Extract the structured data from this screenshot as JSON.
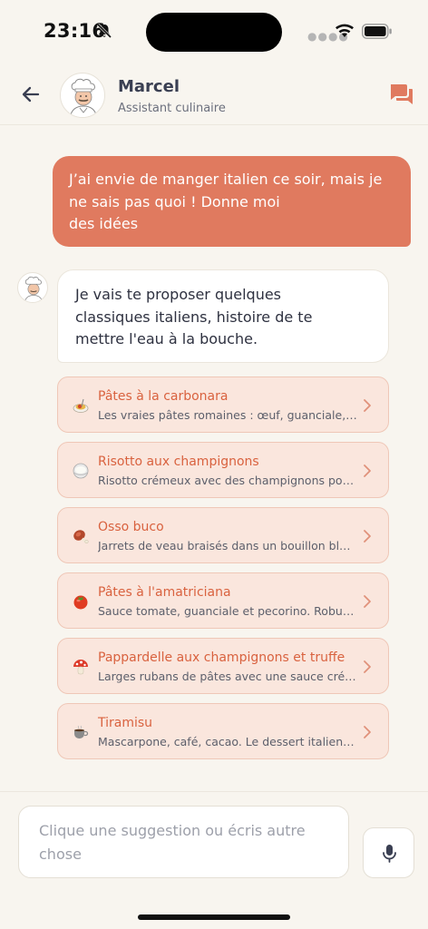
{
  "status_bar": {
    "time": "23:16",
    "icons": [
      "bell-muted-icon",
      "cellular-dots-icon",
      "wifi-icon",
      "battery-icon"
    ]
  },
  "header": {
    "back_icon": "arrow-left-icon",
    "name": "Marcel",
    "subtitle": "Assistant culinaire",
    "action_icon": "chat-bubbles-icon",
    "accent_color": "#e07a5f"
  },
  "messages": {
    "user": {
      "line1": "J’ai envie de manger italien ce soir, mais je",
      "line2": "ne sais pas quoi ! Donne moi",
      "line3": "des idées"
    },
    "assistant": {
      "line1": "Je vais te proposer quelques",
      "line2": "classiques italiens, histoire de te",
      "line3": "mettre l'eau à la bouche."
    }
  },
  "suggestions": [
    {
      "icon": "spaghetti-icon",
      "title": "Pâtes à la carbonara",
      "description": "Les vraies pâtes romaines : œuf, guanciale, pecorino et poivre."
    },
    {
      "icon": "rice-bowl-icon",
      "title": "Risotto aux champignons",
      "description": "Risotto crémeux avec des champignons poêlés et parmesan."
    },
    {
      "icon": "meat-on-bone-icon",
      "title": "Osso buco",
      "description": "Jarrets de veau braisés dans un bouillon blanc et gremolata."
    },
    {
      "icon": "tomato-icon",
      "title": "Pâtes à l'amatriciana",
      "description": "Sauce tomate, guanciale et pecorino. Robuste et savoureuse."
    },
    {
      "icon": "mushroom-icon",
      "title": "Pappardelle aux champignons et truffe",
      "description": "Larges rubans de pâtes avec une sauce crémeuse à la truffe."
    },
    {
      "icon": "coffee-cup-icon",
      "title": "Tiramisu",
      "description": "Mascarpone, café, cacao. Le dessert italien par excellence."
    }
  ],
  "composer": {
    "placeholder_line1": "Clique une suggestion ou écris autre",
    "placeholder_line2": "chose",
    "mic_icon": "microphone-icon"
  }
}
